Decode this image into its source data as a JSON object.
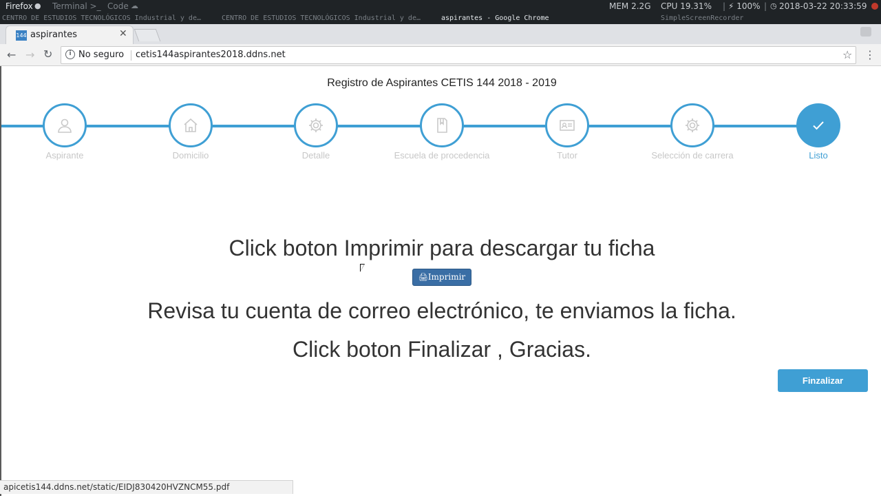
{
  "desktop_panel": {
    "apps": [
      "Firefox",
      "Terminal >_",
      "Code"
    ],
    "mem": "MEM 2.2G",
    "cpu": "CPU 19.31%",
    "battery": "⚡ 100%",
    "datetime": "2018-03-22 20:33:59",
    "windows": [
      "CENTRO DE ESTUDIOS TECNOLÓGICOS Industrial y de…",
      "CENTRO DE ESTUDIOS TECNOLÓGICOS Industrial y de…",
      "aspirantes - Google Chrome",
      "SimpleScreenRecorder"
    ]
  },
  "browser": {
    "tab_title": "aspirantes",
    "favicon_text": "144",
    "security_label": "No seguro",
    "url": "cetis144aspirantes2018.ddns.net",
    "status_url": "apicetis144.ddns.net/static/EIDJ830420HVZNCM55.pdf"
  },
  "page": {
    "title": "Registro de Aspirantes CETIS 144 2018 - 2019",
    "steps": [
      {
        "label": "Aspirante",
        "icon": "user-icon"
      },
      {
        "label": "Domicilio",
        "icon": "home-icon"
      },
      {
        "label": "Detalle",
        "icon": "gear-icon"
      },
      {
        "label": "Escuela de procedencia",
        "icon": "book-icon"
      },
      {
        "label": "Tutor",
        "icon": "id-card-icon"
      },
      {
        "label": "Selección de carrera",
        "icon": "gear-icon"
      },
      {
        "label": "Listo",
        "icon": "check-icon"
      }
    ],
    "message_print": "Click boton Imprimir para descargar tu ficha",
    "print_button": "Imprimir",
    "message_email": "Revisa tu cuenta de correo electrónico, te enviamos la ficha.",
    "message_finish": "Click boton Finalizar , Gracias.",
    "finish_button": "Finzalizar"
  },
  "colors": {
    "accent": "#3f9fd4",
    "print_button": "#3a6ea5",
    "inactive_label": "#c7c7c7"
  }
}
